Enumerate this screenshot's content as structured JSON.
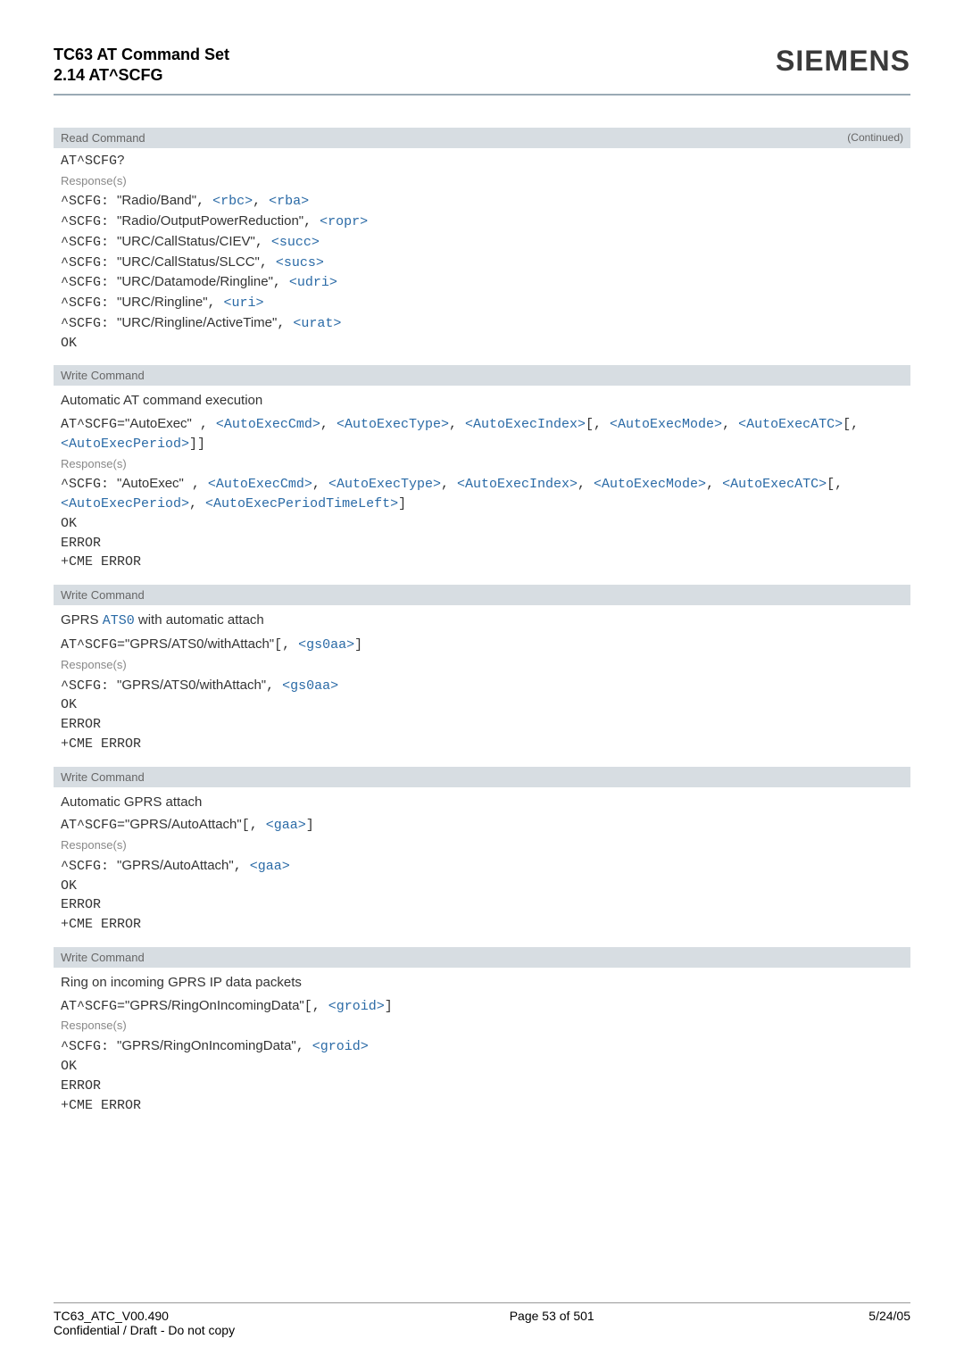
{
  "header": {
    "title_line1": "TC63 AT Command Set",
    "title_line2": "2.14 AT^SCFG",
    "brand": "SIEMENS"
  },
  "readSection": {
    "barLabel": "Read Command",
    "continued": "(Continued)",
    "cmd": "AT^SCFG?",
    "respLabel": "Response(s)",
    "lines": [
      {
        "prefix": "^SCFG: ",
        "quoted": "\"Radio/Band\"",
        "params": [
          "<rbc>",
          "<rba>"
        ]
      },
      {
        "prefix": "^SCFG: ",
        "quoted": "\"Radio/OutputPowerReduction\"",
        "params": [
          "<ropr>"
        ]
      },
      {
        "prefix": "^SCFG: ",
        "quoted": "\"URC/CallStatus/CIEV\"",
        "params": [
          "<succ>"
        ]
      },
      {
        "prefix": "^SCFG: ",
        "quoted": "\"URC/CallStatus/SLCC\"",
        "params": [
          "<sucs>"
        ]
      },
      {
        "prefix": "^SCFG: ",
        "quoted": "\"URC/Datamode/Ringline\"",
        "params": [
          "<udri>"
        ]
      },
      {
        "prefix": "^SCFG: ",
        "quoted": "\"URC/Ringline\"",
        "params": [
          "<uri>"
        ]
      },
      {
        "prefix": "^SCFG: ",
        "quoted": "\"URC/Ringline/ActiveTime\"",
        "params": [
          "<urat>"
        ]
      }
    ],
    "ok": "OK"
  },
  "writeSections": [
    {
      "bar": "Write Command",
      "subtitle": "Automatic AT command execution",
      "cmdPrefix": "AT^SCFG=",
      "cmdQuoted": "\"AutoExec\"",
      "cmdTail": [
        " , ",
        {
          "p": "<AutoExecCmd>"
        },
        ", ",
        {
          "p": "<AutoExecType>"
        },
        ", ",
        {
          "p": "<AutoExecIndex>"
        },
        "[, ",
        {
          "p": "<AutoExecMode>"
        },
        ", ",
        {
          "p": "<AutoExecATC>"
        },
        "[, ",
        {
          "p": "<AutoExecPeriod>"
        },
        "]]"
      ],
      "respLabel": "Response(s)",
      "respLines": [
        {
          "prefix": "^SCFG: ",
          "quoted": "\"AutoExec\"",
          "tail": [
            " , ",
            {
              "p": "<AutoExecCmd>"
            },
            ", ",
            {
              "p": "<AutoExecType>"
            },
            ", ",
            {
              "p": "<AutoExecIndex>"
            },
            ", ",
            {
              "p": "<AutoExecMode>"
            },
            ", ",
            {
              "p": "<AutoExecATC>"
            },
            "[, ",
            {
              "p": "<AutoExecPeriod>"
            },
            ", ",
            {
              "p": "<AutoExecPeriodTimeLeft>"
            },
            "]"
          ]
        }
      ],
      "status": [
        "OK",
        "ERROR",
        "+CME ERROR"
      ]
    },
    {
      "bar": "Write Command",
      "subtitlePrefix": "GPRS ",
      "subtitleLink": "ATS0",
      "subtitleSuffix": " with automatic attach",
      "cmdPrefix": "AT^SCFG=",
      "cmdQuoted": "\"GPRS/ATS0/withAttach\"",
      "cmdTail": [
        "[, ",
        {
          "p": "<gs0aa>"
        },
        "]"
      ],
      "respLabel": "Response(s)",
      "respLines": [
        {
          "prefix": "^SCFG: ",
          "quoted": "\"GPRS/ATS0/withAttach\"",
          "tail": [
            ", ",
            {
              "p": "<gs0aa>"
            }
          ]
        }
      ],
      "status": [
        "OK",
        "ERROR",
        "+CME ERROR"
      ]
    },
    {
      "bar": "Write Command",
      "subtitle": "Automatic GPRS attach",
      "cmdPrefix": "AT^SCFG=",
      "cmdQuoted": "\"GPRS/AutoAttach\"",
      "cmdTail": [
        "[, ",
        {
          "p": "<gaa>"
        },
        "]"
      ],
      "respLabel": "Response(s)",
      "respLines": [
        {
          "prefix": "^SCFG: ",
          "quoted": "\"GPRS/AutoAttach\"",
          "tail": [
            ", ",
            {
              "p": "<gaa>"
            }
          ]
        }
      ],
      "status": [
        "OK",
        "ERROR",
        "+CME ERROR"
      ]
    },
    {
      "bar": "Write Command",
      "subtitle": "Ring on incoming GPRS IP data packets",
      "cmdPrefix": "AT^SCFG=",
      "cmdQuoted": "\"GPRS/RingOnIncomingData\"",
      "cmdTail": [
        "[, ",
        {
          "p": "<groid>"
        },
        "]"
      ],
      "respLabel": "Response(s)",
      "respLines": [
        {
          "prefix": "^SCFG: ",
          "quoted": "\"GPRS/RingOnIncomingData\"",
          "tail": [
            ", ",
            {
              "p": "<groid>"
            }
          ]
        }
      ],
      "status": [
        "OK",
        "ERROR",
        "+CME ERROR"
      ]
    }
  ],
  "footer": {
    "left1": "TC63_ATC_V00.490",
    "left2": "Confidential / Draft - Do not copy",
    "center": "Page 53 of 501",
    "right": "5/24/05"
  }
}
